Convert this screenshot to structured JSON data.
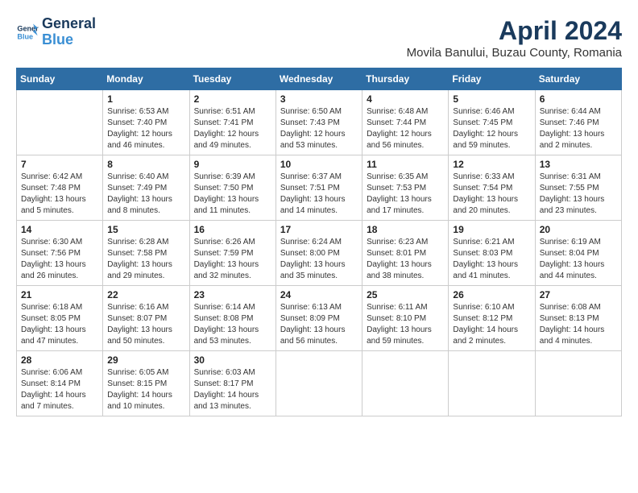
{
  "header": {
    "logo_line1": "General",
    "logo_line2": "Blue",
    "title": "April 2024",
    "subtitle": "Movila Banului, Buzau County, Romania"
  },
  "columns": [
    "Sunday",
    "Monday",
    "Tuesday",
    "Wednesday",
    "Thursday",
    "Friday",
    "Saturday"
  ],
  "weeks": [
    [
      {
        "day": "",
        "info": ""
      },
      {
        "day": "1",
        "info": "Sunrise: 6:53 AM\nSunset: 7:40 PM\nDaylight: 12 hours\nand 46 minutes."
      },
      {
        "day": "2",
        "info": "Sunrise: 6:51 AM\nSunset: 7:41 PM\nDaylight: 12 hours\nand 49 minutes."
      },
      {
        "day": "3",
        "info": "Sunrise: 6:50 AM\nSunset: 7:43 PM\nDaylight: 12 hours\nand 53 minutes."
      },
      {
        "day": "4",
        "info": "Sunrise: 6:48 AM\nSunset: 7:44 PM\nDaylight: 12 hours\nand 56 minutes."
      },
      {
        "day": "5",
        "info": "Sunrise: 6:46 AM\nSunset: 7:45 PM\nDaylight: 12 hours\nand 59 minutes."
      },
      {
        "day": "6",
        "info": "Sunrise: 6:44 AM\nSunset: 7:46 PM\nDaylight: 13 hours\nand 2 minutes."
      }
    ],
    [
      {
        "day": "7",
        "info": "Sunrise: 6:42 AM\nSunset: 7:48 PM\nDaylight: 13 hours\nand 5 minutes."
      },
      {
        "day": "8",
        "info": "Sunrise: 6:40 AM\nSunset: 7:49 PM\nDaylight: 13 hours\nand 8 minutes."
      },
      {
        "day": "9",
        "info": "Sunrise: 6:39 AM\nSunset: 7:50 PM\nDaylight: 13 hours\nand 11 minutes."
      },
      {
        "day": "10",
        "info": "Sunrise: 6:37 AM\nSunset: 7:51 PM\nDaylight: 13 hours\nand 14 minutes."
      },
      {
        "day": "11",
        "info": "Sunrise: 6:35 AM\nSunset: 7:53 PM\nDaylight: 13 hours\nand 17 minutes."
      },
      {
        "day": "12",
        "info": "Sunrise: 6:33 AM\nSunset: 7:54 PM\nDaylight: 13 hours\nand 20 minutes."
      },
      {
        "day": "13",
        "info": "Sunrise: 6:31 AM\nSunset: 7:55 PM\nDaylight: 13 hours\nand 23 minutes."
      }
    ],
    [
      {
        "day": "14",
        "info": "Sunrise: 6:30 AM\nSunset: 7:56 PM\nDaylight: 13 hours\nand 26 minutes."
      },
      {
        "day": "15",
        "info": "Sunrise: 6:28 AM\nSunset: 7:58 PM\nDaylight: 13 hours\nand 29 minutes."
      },
      {
        "day": "16",
        "info": "Sunrise: 6:26 AM\nSunset: 7:59 PM\nDaylight: 13 hours\nand 32 minutes."
      },
      {
        "day": "17",
        "info": "Sunrise: 6:24 AM\nSunset: 8:00 PM\nDaylight: 13 hours\nand 35 minutes."
      },
      {
        "day": "18",
        "info": "Sunrise: 6:23 AM\nSunset: 8:01 PM\nDaylight: 13 hours\nand 38 minutes."
      },
      {
        "day": "19",
        "info": "Sunrise: 6:21 AM\nSunset: 8:03 PM\nDaylight: 13 hours\nand 41 minutes."
      },
      {
        "day": "20",
        "info": "Sunrise: 6:19 AM\nSunset: 8:04 PM\nDaylight: 13 hours\nand 44 minutes."
      }
    ],
    [
      {
        "day": "21",
        "info": "Sunrise: 6:18 AM\nSunset: 8:05 PM\nDaylight: 13 hours\nand 47 minutes."
      },
      {
        "day": "22",
        "info": "Sunrise: 6:16 AM\nSunset: 8:07 PM\nDaylight: 13 hours\nand 50 minutes."
      },
      {
        "day": "23",
        "info": "Sunrise: 6:14 AM\nSunset: 8:08 PM\nDaylight: 13 hours\nand 53 minutes."
      },
      {
        "day": "24",
        "info": "Sunrise: 6:13 AM\nSunset: 8:09 PM\nDaylight: 13 hours\nand 56 minutes."
      },
      {
        "day": "25",
        "info": "Sunrise: 6:11 AM\nSunset: 8:10 PM\nDaylight: 13 hours\nand 59 minutes."
      },
      {
        "day": "26",
        "info": "Sunrise: 6:10 AM\nSunset: 8:12 PM\nDaylight: 14 hours\nand 2 minutes."
      },
      {
        "day": "27",
        "info": "Sunrise: 6:08 AM\nSunset: 8:13 PM\nDaylight: 14 hours\nand 4 minutes."
      }
    ],
    [
      {
        "day": "28",
        "info": "Sunrise: 6:06 AM\nSunset: 8:14 PM\nDaylight: 14 hours\nand 7 minutes."
      },
      {
        "day": "29",
        "info": "Sunrise: 6:05 AM\nSunset: 8:15 PM\nDaylight: 14 hours\nand 10 minutes."
      },
      {
        "day": "30",
        "info": "Sunrise: 6:03 AM\nSunset: 8:17 PM\nDaylight: 14 hours\nand 13 minutes."
      },
      {
        "day": "",
        "info": ""
      },
      {
        "day": "",
        "info": ""
      },
      {
        "day": "",
        "info": ""
      },
      {
        "day": "",
        "info": ""
      }
    ]
  ]
}
